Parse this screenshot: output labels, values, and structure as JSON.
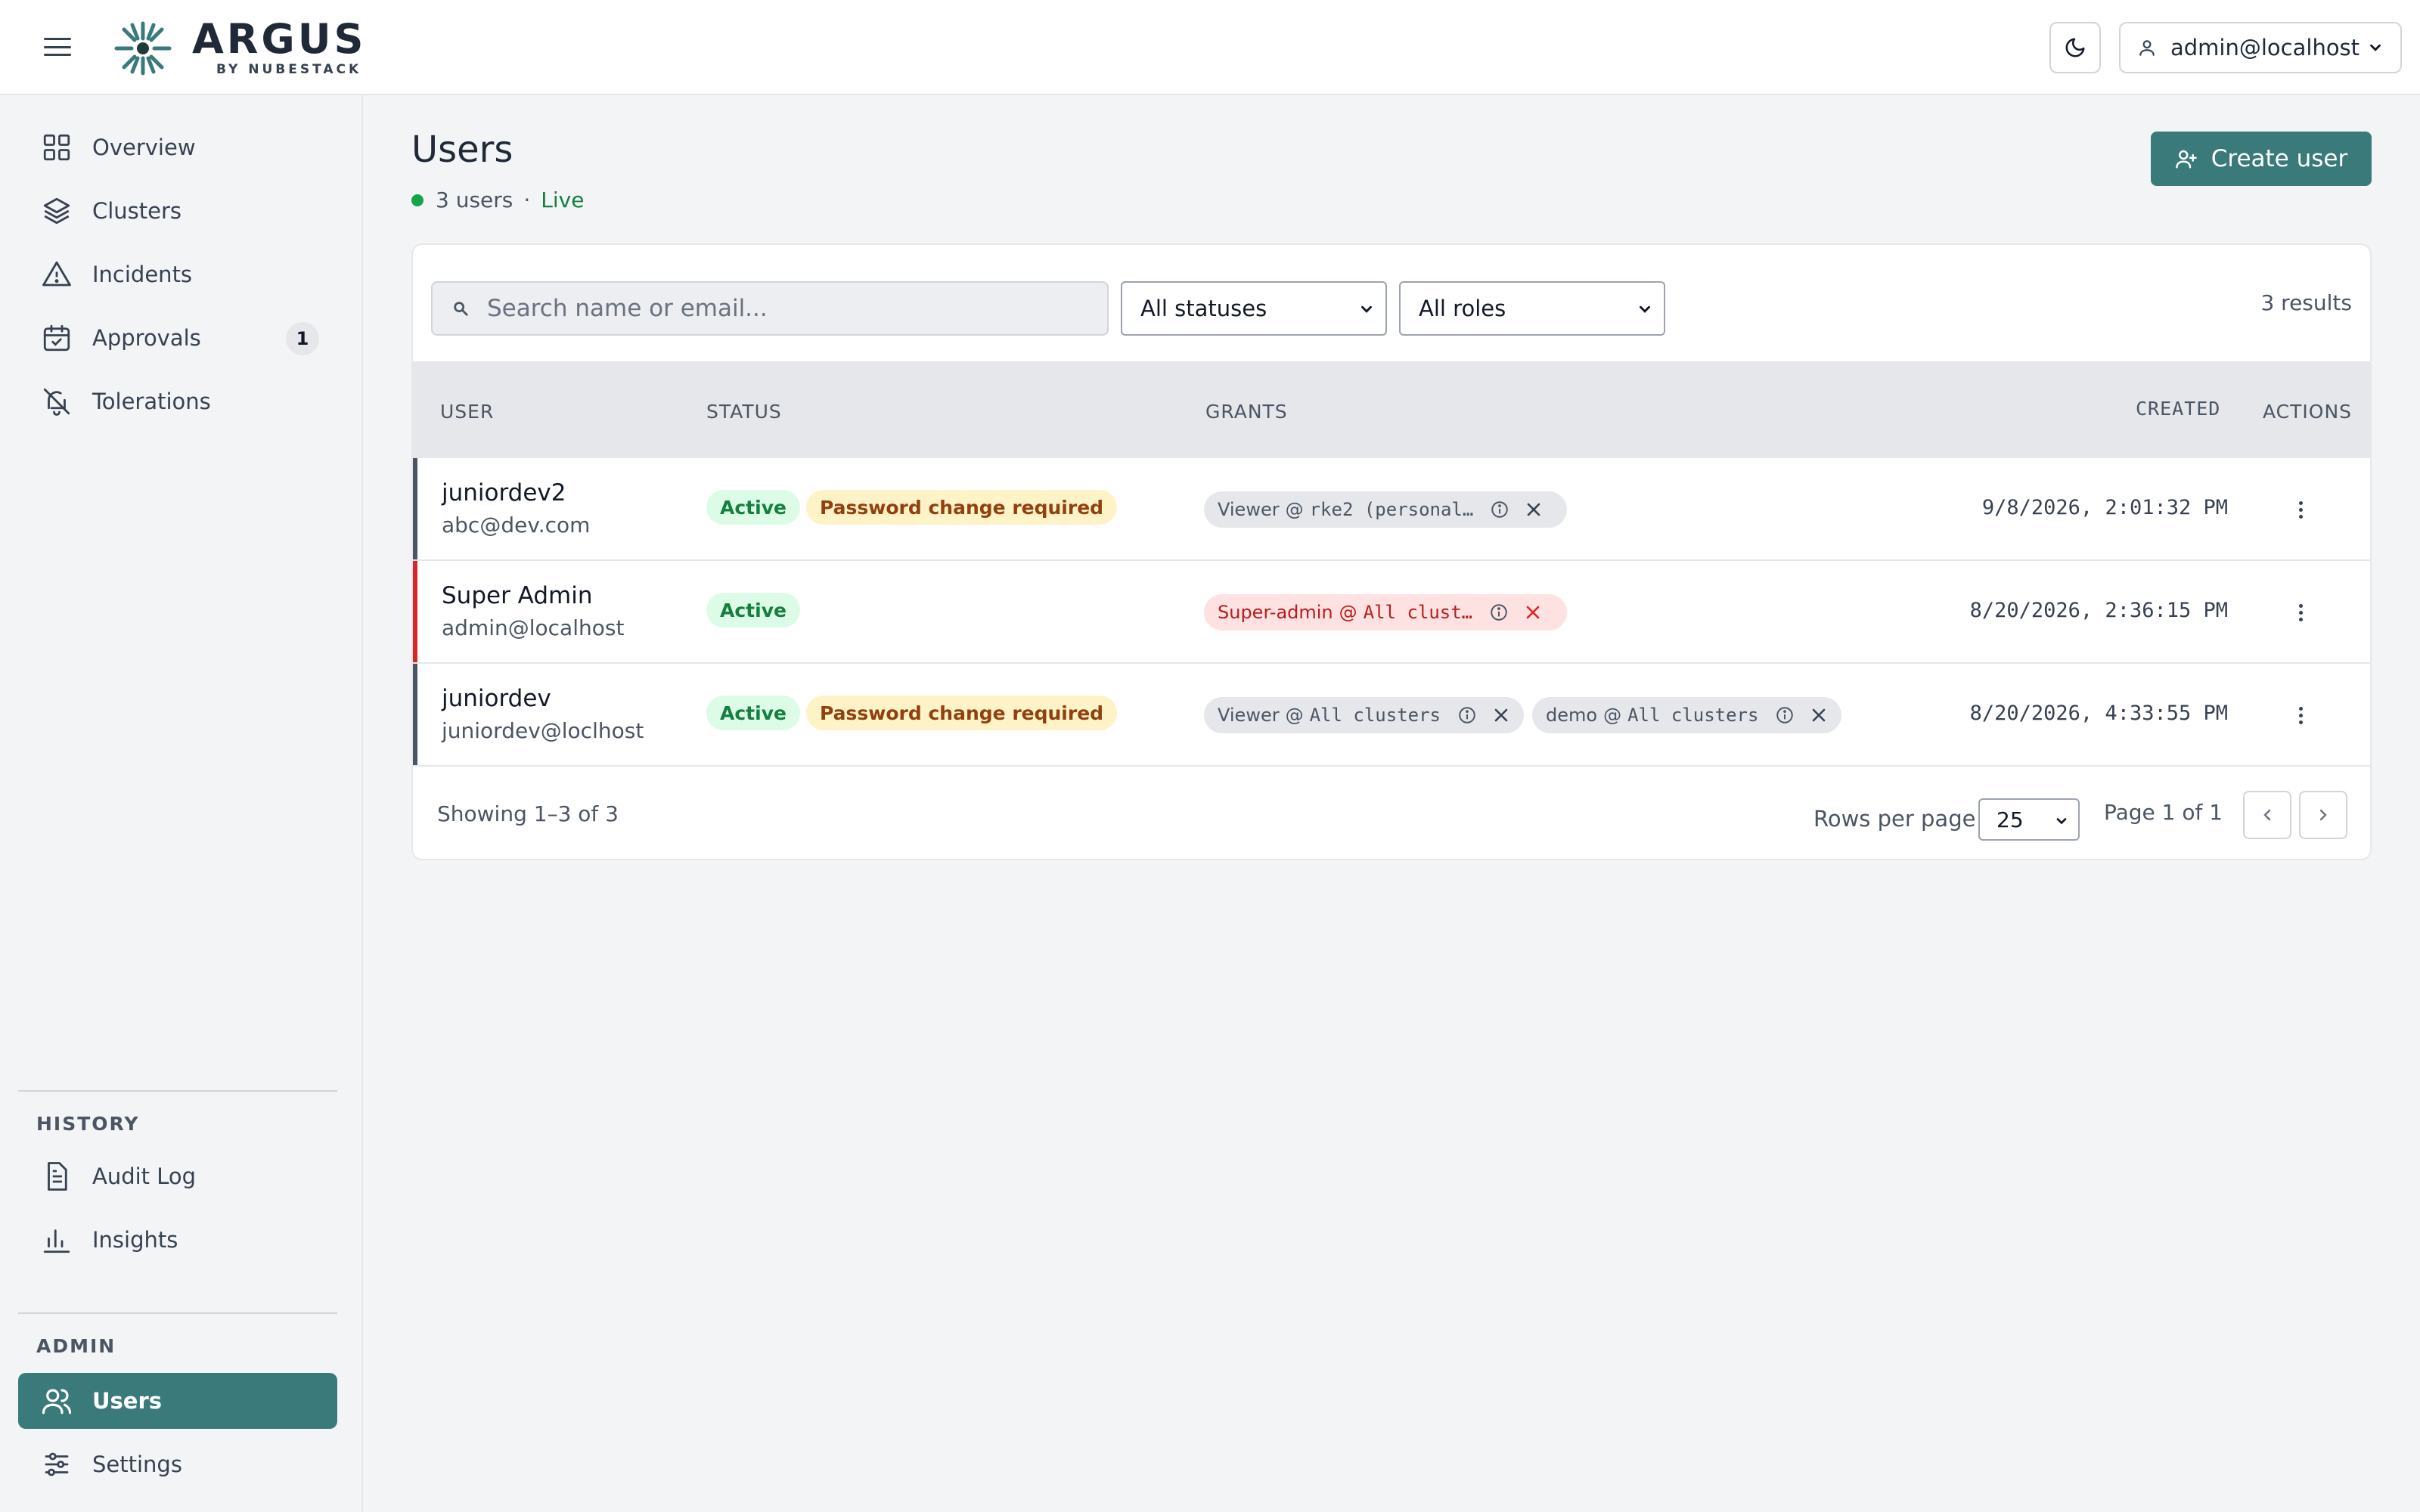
{
  "header": {
    "brand_name": "ARGUS",
    "brand_sub": "BY NUBESTACK",
    "account_label": "admin@localhost"
  },
  "sidebar": {
    "items": [
      {
        "label": "Overview",
        "icon": "grid-icon"
      },
      {
        "label": "Clusters",
        "icon": "layers-icon"
      },
      {
        "label": "Incidents",
        "icon": "warning-triangle-icon"
      },
      {
        "label": "Approvals",
        "icon": "calendar-check-icon",
        "badge": "1"
      },
      {
        "label": "Tolerations",
        "icon": "bell-off-icon"
      }
    ],
    "history_title": "HISTORY",
    "history_items": [
      {
        "label": "Audit Log",
        "icon": "document-icon"
      },
      {
        "label": "Insights",
        "icon": "bar-chart-icon"
      }
    ],
    "admin_title": "ADMIN",
    "admin_items": [
      {
        "label": "Users",
        "icon": "users-icon",
        "active": true
      },
      {
        "label": "Settings",
        "icon": "sliders-icon"
      }
    ]
  },
  "main": {
    "title": "Users",
    "user_count": "3 users",
    "separator": "·",
    "live_label": "Live",
    "create_button": "Create user",
    "search_placeholder": "Search name or email...",
    "status_filter": "All statuses",
    "role_filter": "All roles",
    "results": "3 results",
    "columns": {
      "user": "USER",
      "status": "STATUS",
      "grants": "GRANTS",
      "created": "CREATED",
      "actions": "ACTIONS"
    },
    "rows": [
      {
        "name": "juniordev2",
        "email": "abc@dev.com",
        "status": "Active",
        "flag": "Password change required",
        "grants": [
          {
            "role": "Viewer",
            "at": "@",
            "scope": "rke2 (personal…"
          }
        ],
        "created": "9/8/2026, 2:01:32 PM"
      },
      {
        "name": "Super Admin",
        "email": "admin@localhost",
        "status": "Active",
        "grants": [
          {
            "role": "Super-admin",
            "at": "@",
            "scope": "All clust…"
          }
        ],
        "created": "8/20/2026, 2:36:15 PM"
      },
      {
        "name": "juniordev",
        "email": "juniordev@loclhost",
        "status": "Active",
        "flag": "Password change required",
        "grants": [
          {
            "role": "Viewer",
            "at": "@",
            "scope": "All clusters"
          },
          {
            "role": "demo",
            "at": "@",
            "scope": "All clusters"
          }
        ],
        "created": "8/20/2026, 4:33:55 PM"
      }
    ],
    "footer": {
      "showing": "Showing 1–3 of 3",
      "rows_per_page_label": "Rows per page",
      "rows_per_page": "25",
      "page_info": "Page 1 of 1"
    }
  },
  "colors": {
    "accent": "#3b7a7a",
    "success": "#15803d",
    "danger": "#b91c1c",
    "warning": "#92400e"
  }
}
